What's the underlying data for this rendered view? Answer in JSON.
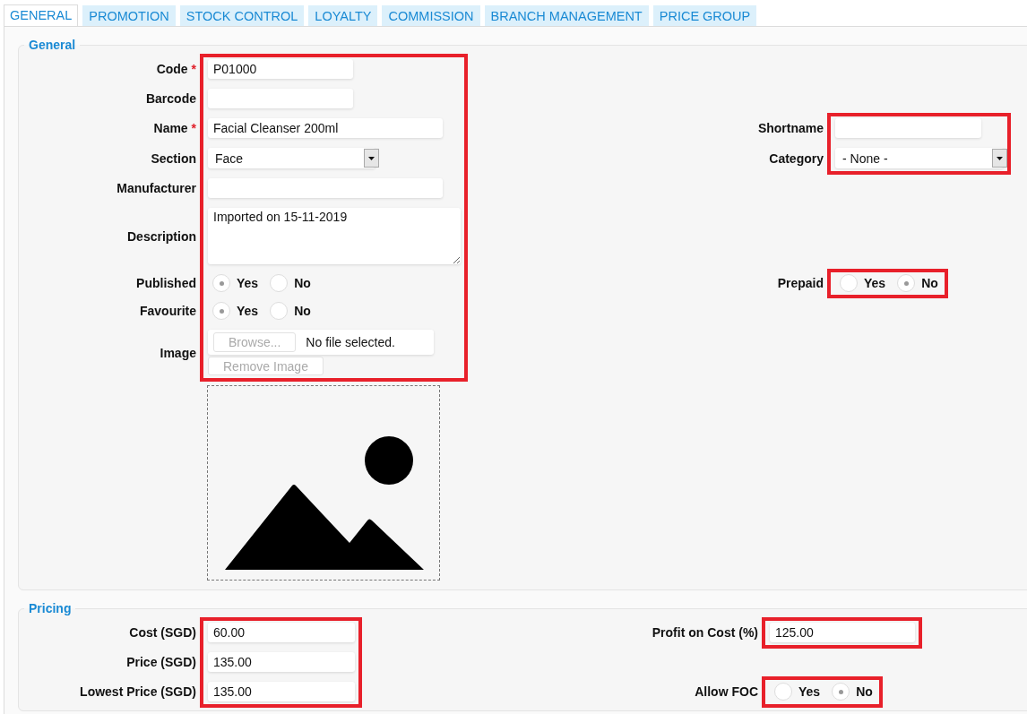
{
  "tabs": [
    {
      "label": "GENERAL",
      "selected": true
    },
    {
      "label": "PROMOTION",
      "selected": false
    },
    {
      "label": "STOCK CONTROL",
      "selected": false
    },
    {
      "label": "LOYALTY",
      "selected": false
    },
    {
      "label": "COMMISSION",
      "selected": false
    },
    {
      "label": "BRANCH MANAGEMENT",
      "selected": false
    },
    {
      "label": "PRICE GROUP",
      "selected": false
    }
  ],
  "sections": [
    {
      "legend": "General",
      "rows": [
        {
          "label": "Code",
          "required_mark": "*",
          "field": {
            "kind": "text",
            "value": "P01000",
            "highlighted": true
          }
        },
        {
          "label": "Barcode",
          "field": {
            "kind": "text",
            "highlighted": true
          }
        },
        {
          "label": "Name",
          "required_mark": "*",
          "field": {
            "kind": "text",
            "value": "Facial Cleanser 200ml",
            "highlighted": true
          },
          "right": {
            "label": "Shortname",
            "field": {
              "kind": "text",
              "highlighted": true
            }
          }
        },
        {
          "label": "Section",
          "field": {
            "kind": "select",
            "value": "Face",
            "highlighted": true
          },
          "right": {
            "label": "Category",
            "field": {
              "kind": "select",
              "value": "- None -",
              "highlighted": true
            }
          }
        },
        {
          "label": "Manufacturer",
          "field": {
            "kind": "text",
            "highlighted": true
          }
        },
        {
          "label": "Description",
          "field": {
            "kind": "textarea",
            "value": "Imported on 15-11-2019",
            "highlighted": true
          }
        },
        {
          "label": "Published",
          "field": {
            "kind": "radio",
            "highlighted": true,
            "options": [
              {
                "label": "Yes",
                "selected": true
              },
              {
                "label": "No",
                "selected": false
              }
            ]
          },
          "right": {
            "label": "Prepaid",
            "field": {
              "kind": "radio",
              "highlighted": true,
              "options": [
                {
                  "label": "Yes",
                  "selected": false
                },
                {
                  "label": "No",
                  "selected": true
                }
              ]
            }
          }
        },
        {
          "label": "Favourite",
          "field": {
            "kind": "radio",
            "highlighted": true,
            "options": [
              {
                "label": "Yes",
                "selected": true
              },
              {
                "label": "No",
                "selected": false
              }
            ]
          }
        },
        {
          "label": "Image",
          "field": {
            "kind": "file",
            "button": "Browse...",
            "status": "No file selected.",
            "remove_button": "Remove Image",
            "disabled": true,
            "highlighted": true
          }
        },
        {
          "field": {
            "kind": "image-placeholder"
          }
        }
      ]
    },
    {
      "legend": "Pricing",
      "rows": [
        {
          "label": "Cost (SGD)",
          "field": {
            "kind": "text",
            "value": "60.00",
            "highlighted": true
          },
          "right": {
            "label": "Profit on Cost (%)",
            "field": {
              "kind": "text",
              "value": "125.00",
              "highlighted": true
            }
          }
        },
        {
          "label": "Price (SGD)",
          "field": {
            "kind": "text",
            "value": "135.00",
            "highlighted": true
          }
        },
        {
          "label": "Lowest Price (SGD)",
          "field": {
            "kind": "text",
            "value": "135.00",
            "highlighted": true
          },
          "right": {
            "label": "Allow FOC",
            "field": {
              "kind": "radio",
              "highlighted": true,
              "options": [
                {
                  "label": "Yes",
                  "selected": false
                },
                {
                  "label": "No",
                  "selected": true
                }
              ]
            }
          }
        }
      ]
    }
  ]
}
